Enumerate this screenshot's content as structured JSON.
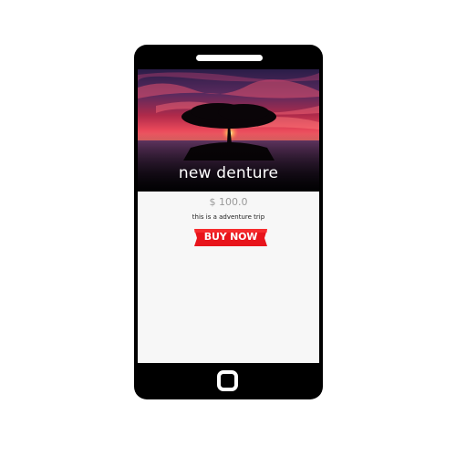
{
  "product": {
    "title": "new denture",
    "price": "$ 100.0",
    "description": "this is a adventure trip",
    "buy_label": "BUY NOW"
  },
  "colors": {
    "buy_button": "#e8141b",
    "phone_frame": "#000000",
    "screen_bg": "#f7f7f7"
  },
  "icons": {
    "home": "home-button-icon",
    "speaker": "speaker-slot"
  }
}
